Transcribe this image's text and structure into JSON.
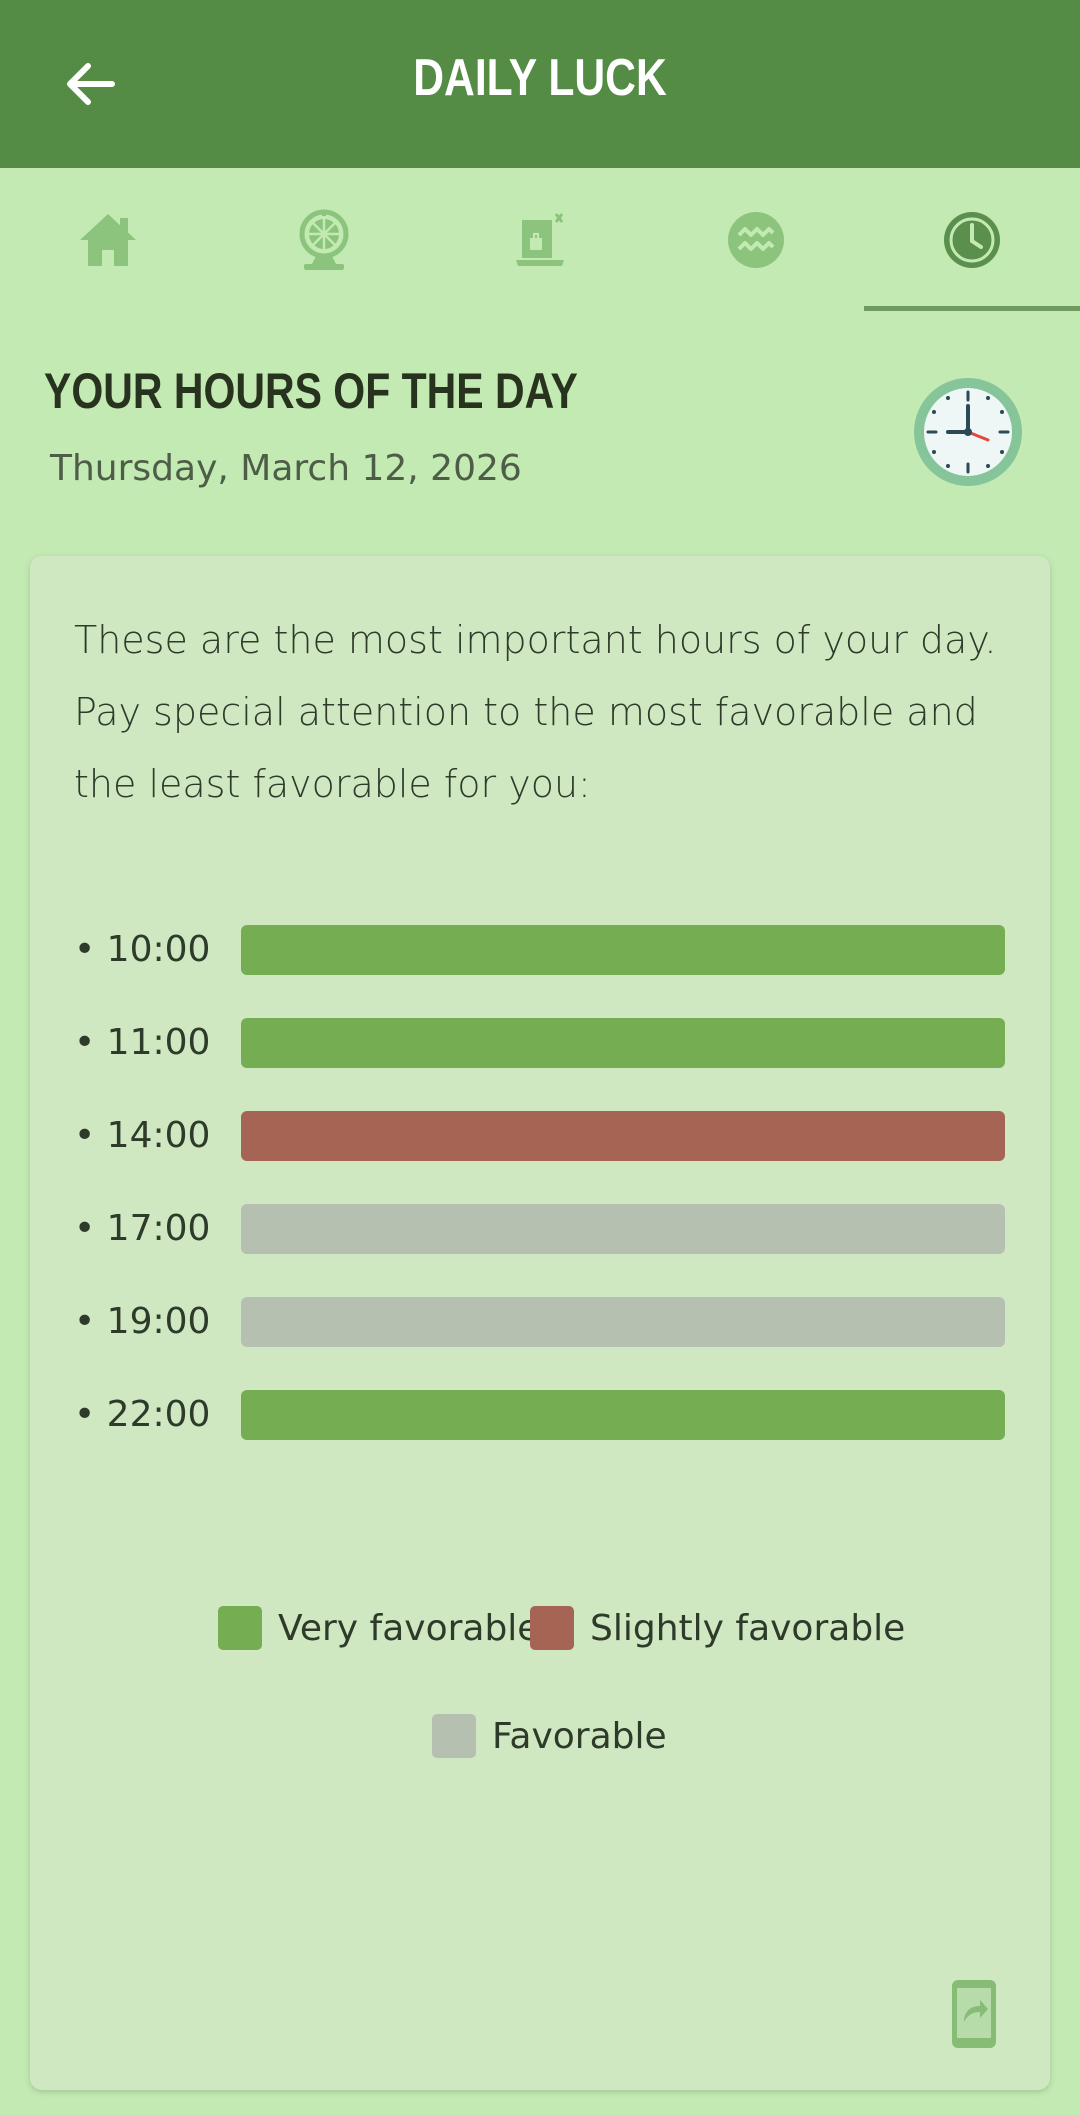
{
  "appbar": {
    "title": "DAILY LUCK",
    "back_icon": "arrow-left-icon"
  },
  "tabs": [
    {
      "icon": "home-icon",
      "active": false
    },
    {
      "icon": "fortune-wheel-icon",
      "active": false
    },
    {
      "icon": "card-icon",
      "active": false
    },
    {
      "icon": "zodiac-aquarius-icon",
      "active": false
    },
    {
      "icon": "clock-icon",
      "active": true
    }
  ],
  "header": {
    "title": "YOUR HOURS OF THE DAY",
    "date": "Thursday, March 12, 2026"
  },
  "card": {
    "intro": "These are the most important hours of your day. Pay special attention to the most favorable and the least favorable for you:",
    "hours": [
      {
        "label": "• 10:00",
        "rating": "Very favorable"
      },
      {
        "label": "• 11:00",
        "rating": "Very favorable"
      },
      {
        "label": "• 14:00",
        "rating": "Slightly favorable"
      },
      {
        "label": "• 17:00",
        "rating": "Favorable"
      },
      {
        "label": "• 19:00",
        "rating": "Favorable"
      },
      {
        "label": "• 22:00",
        "rating": "Very favorable"
      }
    ],
    "legend": [
      {
        "label": "Very favorable",
        "color": "#75ae52"
      },
      {
        "label": "Slightly favorable",
        "color": "#a66455"
      },
      {
        "label": "Favorable",
        "color": "#b5c0b1"
      }
    ],
    "share_icon": "share-phone-icon"
  },
  "colors": {
    "appbar": "#548c46",
    "background": "#c3eab3",
    "card": "#cfe8c2",
    "tab_icon": "#8cc47e",
    "tab_icon_active": "#5b8f4d"
  }
}
